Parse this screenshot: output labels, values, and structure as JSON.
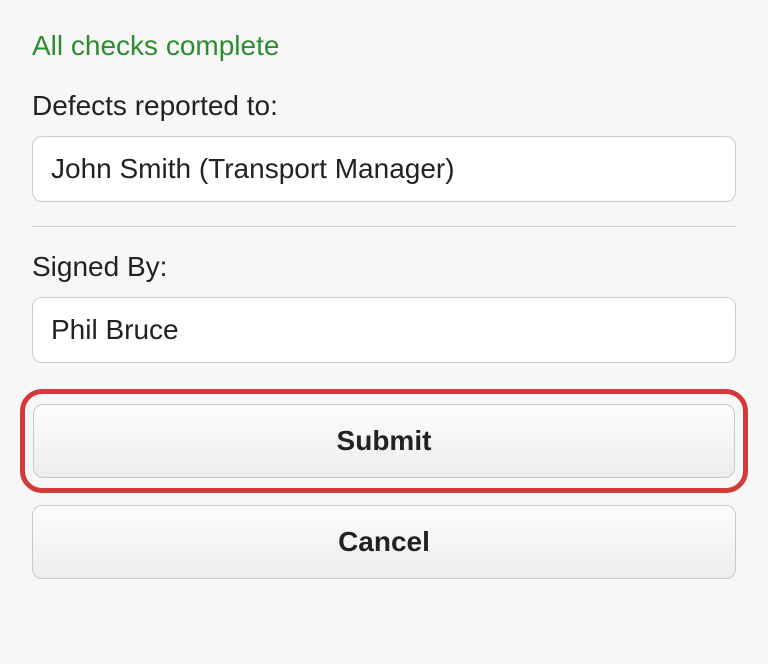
{
  "status": "All checks complete",
  "fields": {
    "defects_reported_to": {
      "label": "Defects reported to:",
      "value": "John Smith (Transport Manager)"
    },
    "signed_by": {
      "label": "Signed By:",
      "value": "Phil Bruce"
    }
  },
  "buttons": {
    "submit": "Submit",
    "cancel": "Cancel"
  }
}
